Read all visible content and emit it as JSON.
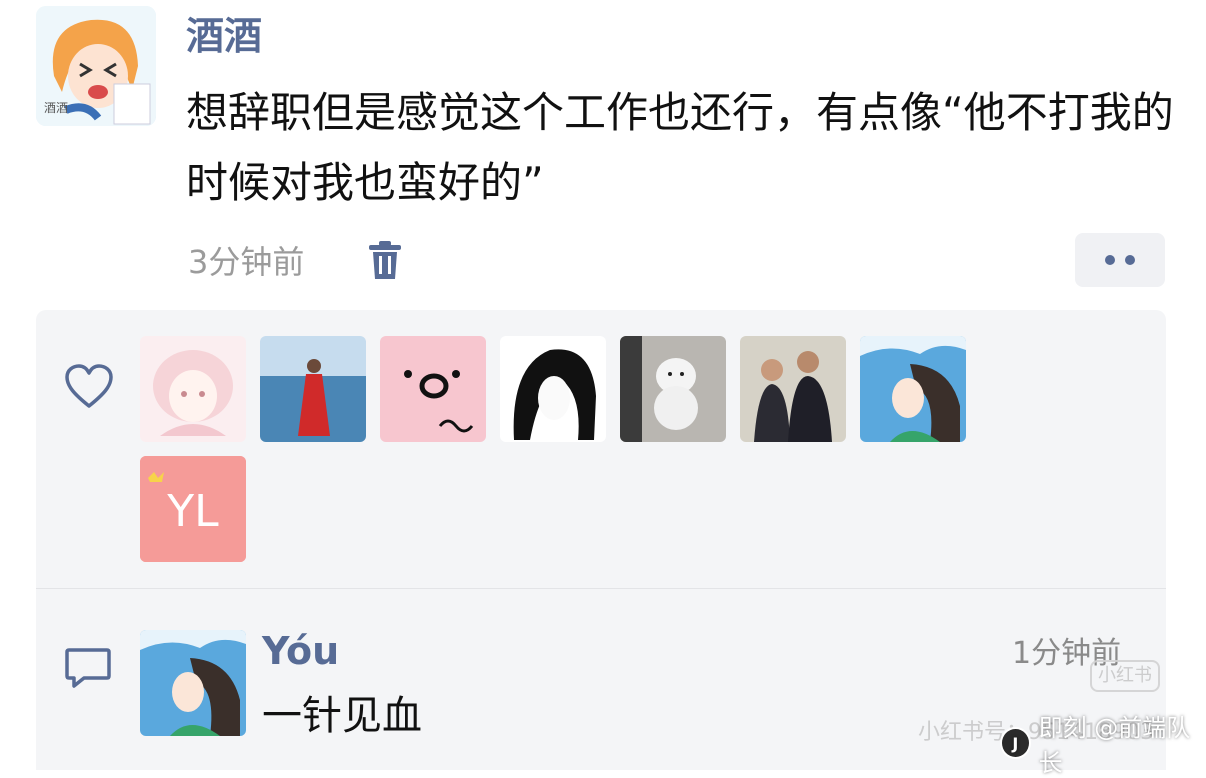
{
  "post": {
    "username": "酒酒",
    "text": "想辞职但是感觉这个工作也还行，有点像“他不打我的时候对我也蛮好的”",
    "time": "3分钟前"
  },
  "likes": {
    "icon": "heart-icon",
    "avatars": [
      {
        "name": "like-avatar-pink-anime-girl",
        "label": ""
      },
      {
        "name": "like-avatar-woman-red-dress",
        "label": ""
      },
      {
        "name": "like-avatar-pink-face",
        "label": ""
      },
      {
        "name": "like-avatar-ink-girl",
        "label": ""
      },
      {
        "name": "like-avatar-white-dog",
        "label": ""
      },
      {
        "name": "like-avatar-two-men",
        "label": ""
      },
      {
        "name": "like-avatar-sky-girl",
        "label": ""
      },
      {
        "name": "like-avatar-yl",
        "label": "YL"
      }
    ]
  },
  "comment": {
    "username": "Yóu",
    "time": "1分钟前",
    "text": "一针见血"
  },
  "watermark": {
    "badge": "小红书",
    "id_text": "小红书号：951418903",
    "credit_text": "即刻 @前端队长"
  },
  "colors": {
    "name_blue": "#576b95",
    "panel_bg": "#f4f5f7",
    "meta_gray": "#9b9b9b"
  }
}
